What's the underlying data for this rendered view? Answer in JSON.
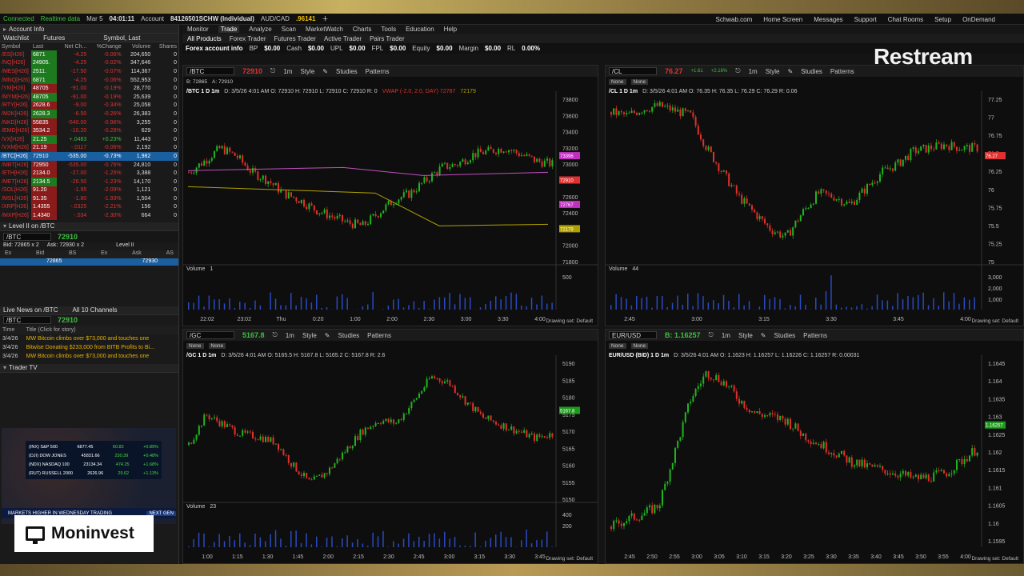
{
  "status": {
    "connected": "Connected",
    "realtime": "Realtime data",
    "date": "Mar 5",
    "time": "04:01:11",
    "account_label": "Account",
    "account_id": "84126501SCHW (Individual)",
    "pair": "AUD/CAD",
    "pair_price": ".96141"
  },
  "top_links": [
    "Schwab.com",
    "Home Screen",
    "Messages",
    "Support",
    "Chat Rooms",
    "Setup",
    "OnDemand"
  ],
  "main_tabs": [
    "Monitor",
    "Trade",
    "Analyze",
    "Scan",
    "MarketWatch",
    "Charts",
    "Tools",
    "Education",
    "Help"
  ],
  "sub_tabs": [
    "All Products",
    "Forex Trader",
    "Futures Trader",
    "Active Trader",
    "Pairs Trader"
  ],
  "fx_info": {
    "label": "Forex account info",
    "bp": "BP",
    "bp_v": "$0.00",
    "cash": "Cash",
    "cash_v": "$0.00",
    "upl": "UPL",
    "upl_v": "$0.00",
    "fpl": "FPL",
    "fpl_v": "$0.00",
    "equity": "Equity",
    "equity_v": "$0.00",
    "margin": "Margin",
    "margin_v": "$0.00",
    "rl": "RL",
    "rl_v": "0.00%"
  },
  "left": {
    "account_info": "Account Info",
    "watchlist_label": "Watchlist",
    "watchlist_name": "Futures",
    "sort_label": "Symbol, Last",
    "columns": [
      "Symbol",
      "Last",
      "Net Ch...",
      "%Change",
      "Volume",
      "Shares"
    ],
    "rows": [
      [
        "/ES[H26]",
        "6871",
        "-4.25",
        "-0.06%",
        "204,650",
        "0",
        "g"
      ],
      [
        "/NQ[H26]",
        "24905.",
        "-4.25",
        "-0.02%",
        "347,646",
        "0",
        "g"
      ],
      [
        "/MES[H26]",
        "2511.",
        "-17.50",
        "-0.07%",
        "114,367",
        "0",
        "g"
      ],
      [
        "/MNQ[H26]",
        "6871",
        "-4.25",
        "-0.06%",
        "552,953",
        "0",
        "g"
      ],
      [
        "/YM[H26]",
        "48705",
        "-91.00",
        "-0.19%",
        "28,770",
        "0",
        "r"
      ],
      [
        "/MYM[H26]",
        "48705",
        "-91.00",
        "-0.19%",
        "25,639",
        "0",
        "g"
      ],
      [
        "/RTY[H26]",
        "2628.6",
        "-9.00",
        "-0.34%",
        "25,058",
        "0",
        "r"
      ],
      [
        "/M2K[H26]",
        "2628.3",
        "-6.50",
        "-0.26%",
        "26,383",
        "0",
        "g"
      ],
      [
        "/NKD[H26]",
        "55835",
        "-540.00",
        "-0.96%",
        "3,255",
        "0",
        "r"
      ],
      [
        "/EMD[H26]",
        "3534.2",
        "-10.20",
        "-0.29%",
        "629",
        "0",
        "r"
      ],
      [
        "/VX[H26]",
        "21.25",
        "+.0483",
        "+0.23%",
        "11,443",
        "0",
        "g"
      ],
      [
        "/VXM[H26]",
        "21.19",
        "-.0117",
        "-0.06%",
        "2,192",
        "0",
        "r"
      ],
      [
        "/BTC[H26]",
        "72910",
        "-535.00",
        "-0.73%",
        "1,982",
        "0",
        "s"
      ],
      [
        "/MBT[H26]",
        "72950",
        "-535.00",
        "-0.76%",
        "24,810",
        "0",
        "r"
      ],
      [
        "/ETH[H26]",
        "2134.0",
        "-27.00",
        "-1.25%",
        "3,388",
        "0",
        "r"
      ],
      [
        "/MET[H26]",
        "2134.5",
        "-26.50",
        "-1.23%",
        "14,170",
        "0",
        "g"
      ],
      [
        "/SOL[H26]",
        "91.20",
        "-1.95",
        "-2.09%",
        "1,121",
        "0",
        "r"
      ],
      [
        "/MSL[H26]",
        "91.35",
        "-1.80",
        "-1.93%",
        "1,504",
        "0",
        "r"
      ],
      [
        "/XRP[H26]",
        "1.4355",
        "-.0325",
        "-2.21%",
        "156",
        "0",
        "r"
      ],
      [
        "/MXP[H26]",
        "1.4340",
        "-.034",
        "-2.30%",
        "664",
        "0",
        "r"
      ]
    ],
    "level2_label": "Level II on /BTC",
    "l2_symbol": "/BTC",
    "l2_price": "72910",
    "bid_line": "Bid: 72865 x 2",
    "ask_line": "Ask: 72930 x 2",
    "level2_btn": "Level II",
    "l2_cols": [
      "Ex",
      "Bid",
      "BS",
      "Ex",
      "Ask",
      "AS"
    ],
    "l2_bid": "72865",
    "l2_ask": "72930",
    "news_label": "Live News on /BTC",
    "news_channels": "All 10 Channels",
    "news_symbol": "/BTC",
    "news_price": "72910",
    "news_cols": [
      "Time",
      "Title (Click for story)"
    ],
    "news": [
      [
        "3/4/26",
        "MW Bitcoin climbs over $73,000 and touches one"
      ],
      [
        "3/4/26",
        "Bitwise Donating $233,000 from BITB Profits to Bi..."
      ],
      [
        "3/4/26",
        "MW Bitcoin climbs over $73,000 and touches one"
      ]
    ],
    "trader_tv": "Trader TV",
    "tv_rows": [
      [
        "(INX) S&P 500",
        "6877.45",
        "60.82",
        "+0.89%"
      ],
      [
        "(DJI) DOW JONES",
        "45831.66",
        "230.39",
        "+0.48%"
      ],
      [
        "(NDX) NASDAQ 100",
        "23134.34",
        "474.25",
        "+1.68%"
      ],
      [
        "(RUT) RUSSELL 2000",
        "2626.96",
        "29.62",
        "+1.13%"
      ]
    ],
    "tv_ticker": "MARKETS HIGHER IN WEDNESDAY TRADING",
    "tv_next": "NEXT GEN"
  },
  "charts": [
    {
      "symbol": "/BTC",
      "price": "72910",
      "bid": "B: 72865",
      "ask": "A: 72910",
      "title": "/BTC 1 D 1m",
      "info": "D: 3/5/26 4:01 AM  O: 72910  H: 72910  L: 72910  C: 72910  R: 0",
      "vwap": "VWAP (-2.0, 2.0, DAY)  72787",
      "vwap2": "72179",
      "studies": "Studies",
      "patterns": "Patterns",
      "style": "Style",
      "interval": "1m",
      "volume_label": "Volume",
      "volume_val": "1",
      "yticks": [
        "73800",
        "73600",
        "73400",
        "73200",
        "73000",
        "72800",
        "72600",
        "72400",
        "72200",
        "72000",
        "71800"
      ],
      "xticks": [
        "22:02",
        "23:02",
        "Thu",
        "0:20",
        "1:00",
        "2:00",
        "2:30",
        "3:00",
        "3:30",
        "4:00"
      ],
      "vol_ticks": [
        "500"
      ],
      "drawing_set": "Drawing set: Default",
      "tags": [
        [
          "73396",
          "#c030c0"
        ],
        [
          "72910",
          "#e03030"
        ],
        [
          "72767",
          "#c030c0"
        ],
        [
          "72179",
          "#b0a000"
        ]
      ]
    },
    {
      "symbol": "/CL",
      "price": "76.27",
      "change": "+1.61",
      "pct": "+2.16%",
      "title": "/CL 1 D 1m",
      "info": "D: 3/5/26 4:01 AM  O: 76.35  H: 76.35  L: 76.29  C: 76.29  R: 0.06",
      "studies": "Studies",
      "patterns": "Patterns",
      "style": "Style",
      "interval": "1m",
      "volume_label": "Volume",
      "volume_val": "44",
      "yticks": [
        "77.25",
        "77",
        "76.75",
        "76.5",
        "76.25",
        "76",
        "75.75",
        "75.5",
        "75.25",
        "75"
      ],
      "xticks": [
        "2:45",
        "3:00",
        "3:15",
        "3:30",
        "3:45",
        "4:00"
      ],
      "vol_ticks": [
        "3,000",
        "2,000",
        "1,000"
      ],
      "drawing_set": "Drawing set: Default",
      "tags": [
        [
          "76.27",
          "#e03030"
        ]
      ],
      "none1": "None",
      "none2": "None"
    },
    {
      "symbol": "/GC",
      "price": "5167.8",
      "title": "/GC 1 D 1m",
      "info": "D: 3/5/26 4:01 AM  O: 5165.5  H: 5167.8  L: 5165.2  C: 5167.8  R: 2.6",
      "studies": "Studies",
      "patterns": "Patterns",
      "style": "Style",
      "interval": "1m",
      "volume_label": "Volume",
      "volume_val": "23",
      "yticks": [
        "5190",
        "5185",
        "5180",
        "5175",
        "5170",
        "5165",
        "5160",
        "5155",
        "5150"
      ],
      "xticks": [
        "1:00",
        "1:15",
        "1:30",
        "1:45",
        "2:00",
        "2:15",
        "2:30",
        "2:45",
        "3:00",
        "3:15",
        "3:30",
        "3:45"
      ],
      "vol_ticks": [
        "400",
        "200"
      ],
      "drawing_set": "Drawing set: Default",
      "tags": [
        [
          "5167.8",
          "#1e9a1e"
        ]
      ],
      "none1": "None",
      "none2": "None"
    },
    {
      "symbol": "EUR/USD",
      "price": "B: 1.16257",
      "title": "EUR/USD (BID) 1 D 1m",
      "info": "D: 3/5/26 4:01 AM  O: 1.1623  H: 1.16257  L: 1.16226  C: 1.16257  R: 0.00031",
      "studies": "Studies",
      "patterns": "Patterns",
      "style": "Style",
      "interval": "1m",
      "yticks": [
        "1.1645",
        "1.164",
        "1.1635",
        "1.163",
        "1.1625",
        "1.162",
        "1.1615",
        "1.161",
        "1.1605",
        "1.16",
        "1.1595"
      ],
      "xticks": [
        "2:45",
        "2:50",
        "2:55",
        "3:00",
        "3:05",
        "3:10",
        "3:15",
        "3:20",
        "3:25",
        "3:30",
        "3:35",
        "3:40",
        "3:45",
        "3:50",
        "3:55",
        "4:00"
      ],
      "drawing_set": "Drawing set: Default",
      "tags": [
        [
          "1.16257",
          "#1e9a1e"
        ]
      ],
      "none1": "None",
      "none2": "None"
    }
  ],
  "overlays": {
    "restream": "Restream",
    "moninvest": "Moninvest"
  }
}
